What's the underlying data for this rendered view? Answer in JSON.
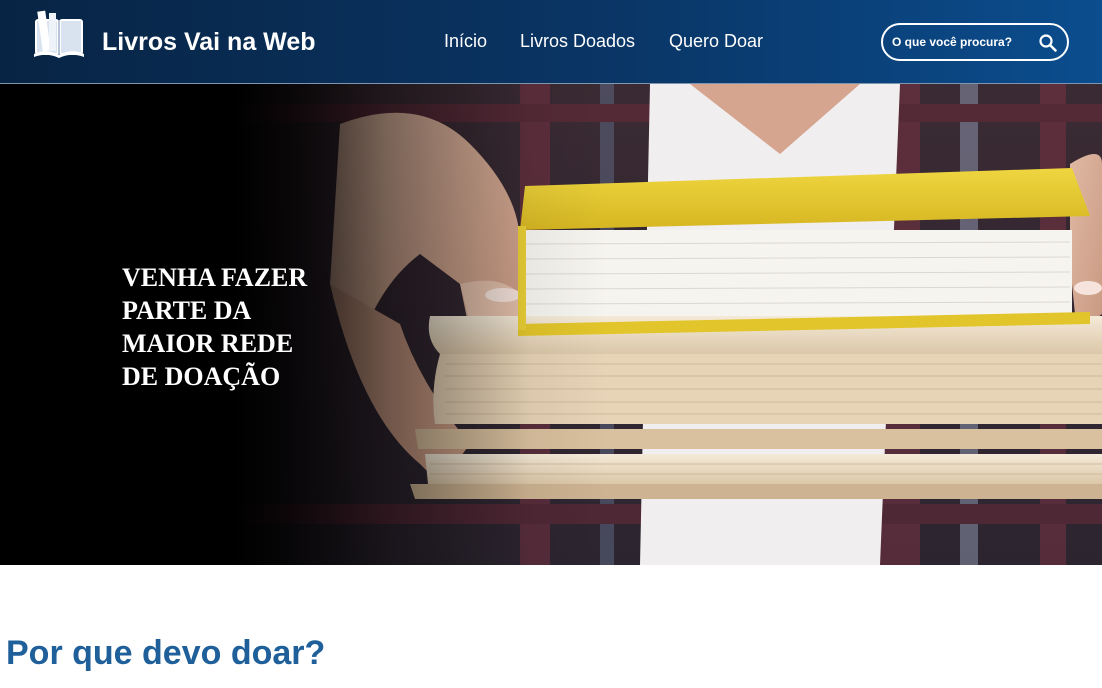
{
  "header": {
    "brand": "Livros Vai na Web",
    "nav": {
      "inicio": "Início",
      "doados": "Livros Doados",
      "doar": "Quero Doar"
    },
    "search": {
      "placeholder": "O que você procura?",
      "icon": "search-icon"
    },
    "logo_icon": "open-book-icon"
  },
  "hero": {
    "headline_lines": [
      "VENHA FAZER",
      "PARTE DA",
      "MAIOR REDE",
      "DE DOAÇÃO"
    ],
    "image": "hands-holding-stack-of-books"
  },
  "section": {
    "title": "Por que devo doar?"
  },
  "colors": {
    "header_dark": "#082444",
    "header_light": "#0b4d8e",
    "section_title": "#1f5f9a",
    "book_yellow": "#e6cb2c"
  }
}
